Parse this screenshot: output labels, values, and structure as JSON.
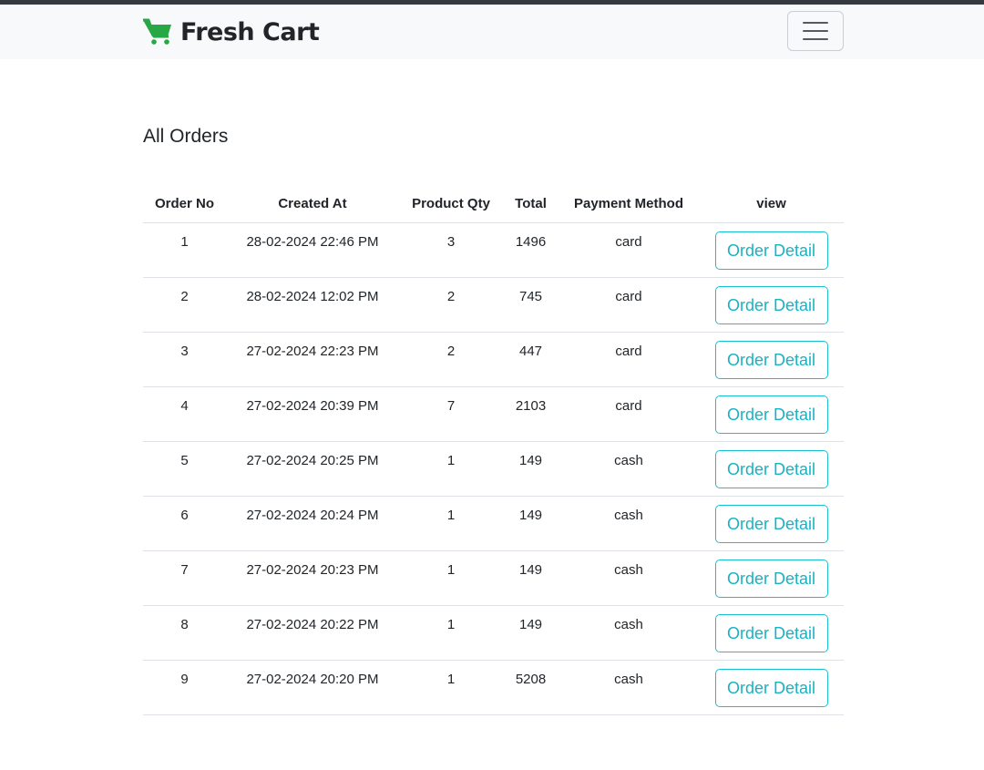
{
  "brand": {
    "name": "Fresh Cart",
    "icon": "shopping-cart-icon",
    "icon_color": "#28a745"
  },
  "nav": {
    "toggler_icon": "hamburger-menu-icon"
  },
  "page": {
    "title": "All Orders"
  },
  "table": {
    "headers": [
      "Order No",
      "Created At",
      "Product Qty",
      "Total",
      "Payment Method",
      "view"
    ],
    "rows": [
      {
        "order_no": "1",
        "created_at": "28-02-2024 22:46 PM",
        "qty": "3",
        "total": "1496",
        "payment": "card",
        "action": "Order Detail"
      },
      {
        "order_no": "2",
        "created_at": "28-02-2024 12:02 PM",
        "qty": "2",
        "total": "745",
        "payment": "card",
        "action": "Order Detail"
      },
      {
        "order_no": "3",
        "created_at": "27-02-2024 22:23 PM",
        "qty": "2",
        "total": "447",
        "payment": "card",
        "action": "Order Detail"
      },
      {
        "order_no": "4",
        "created_at": "27-02-2024 20:39 PM",
        "qty": "7",
        "total": "2103",
        "payment": "card",
        "action": "Order Detail"
      },
      {
        "order_no": "5",
        "created_at": "27-02-2024 20:25 PM",
        "qty": "1",
        "total": "149",
        "payment": "cash",
        "action": "Order Detail"
      },
      {
        "order_no": "6",
        "created_at": "27-02-2024 20:24 PM",
        "qty": "1",
        "total": "149",
        "payment": "cash",
        "action": "Order Detail"
      },
      {
        "order_no": "7",
        "created_at": "27-02-2024 20:23 PM",
        "qty": "1",
        "total": "149",
        "payment": "cash",
        "action": "Order Detail"
      },
      {
        "order_no": "8",
        "created_at": "27-02-2024 20:22 PM",
        "qty": "1",
        "total": "149",
        "payment": "cash",
        "action": "Order Detail"
      },
      {
        "order_no": "9",
        "created_at": "27-02-2024 20:20 PM",
        "qty": "1",
        "total": "5208",
        "payment": "cash",
        "action": "Order Detail"
      }
    ]
  },
  "colors": {
    "accent": "#17a2b8",
    "navbar_bg": "#f8f9fa"
  }
}
